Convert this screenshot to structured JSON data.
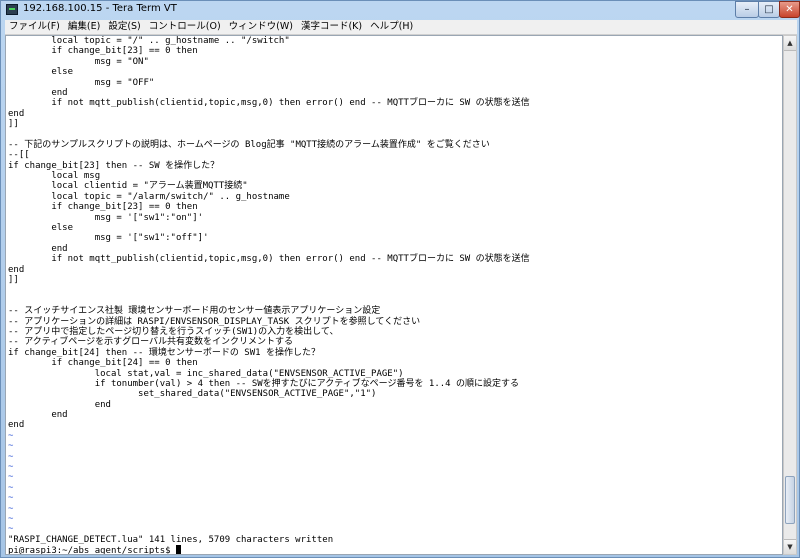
{
  "window": {
    "title": "192.168.100.15 - Tera Term VT",
    "controls": {
      "minimize": "–",
      "maximize": "□",
      "close": "✕"
    }
  },
  "menu": [
    "ファイル(F)",
    "編集(E)",
    "設定(S)",
    "コントロール(O)",
    "ウィンドウ(W)",
    "漢字コード(K)",
    "ヘルプ(H)"
  ],
  "terminal": {
    "lines": [
      "        local topic = \"/\" .. g_hostname .. \"/switch\"",
      "        if change_bit[23] == 0 then",
      "                msg = \"ON\"",
      "        else",
      "                msg = \"OFF\"",
      "        end",
      "        if not mqtt_publish(clientid,topic,msg,0) then error() end -- MQTTブローカに SW の状態を送信",
      "end",
      "]]",
      "",
      "-- 下記のサンプルスクリプトの説明は、ホームページの Blog記事 \"MQTT接続のアラーム装置作成\" をご覧ください",
      "--[[",
      "if change_bit[23] then -- SW を操作した？",
      "        local msg",
      "        local clientid = \"アラーム装置MQTT接続\"",
      "        local topic = \"/alarm/switch/\" .. g_hostname",
      "        if change_bit[23] == 0 then",
      "                msg = '[\"sw1\":\"on\"]'",
      "        else",
      "                msg = '[\"sw1\":\"off\"]'",
      "        end",
      "        if not mqtt_publish(clientid,topic,msg,0) then error() end -- MQTTブローカに SW の状態を送信",
      "end",
      "]]",
      "",
      "",
      "-- スイッチサイエンス社製 環境センサーボード用のセンサー値表示アプリケーション設定",
      "-- アプリケーションの詳細は RASPI/ENVSENSOR_DISPLAY_TASK スクリプトを参照してください",
      "-- アプリ中で指定したページ切り替えを行うスイッチ(SW1)の入力を検出して、",
      "-- アクティブページを示すグローバル共有変数をインクリメントする",
      "if change_bit[24] then -- 環境センサーボードの SW1 を操作した？",
      "        if change_bit[24] == 0 then",
      "                local stat,val = inc_shared_data(\"ENVSENSOR_ACTIVE_PAGE\")",
      "                if tonumber(val) > 4 then -- SWを押すたびにアクティブなページ番号を 1..4 の順に設定する",
      "                        set_shared_data(\"ENVSENSOR_ACTIVE_PAGE\",\"1\")",
      "                end",
      "        end",
      "end",
      "~",
      "~",
      "~",
      "~",
      "~",
      "~",
      "~",
      "~",
      "~",
      "~",
      "\"RASPI_CHANGE_DETECT.lua\" 141 lines, 5709 characters written",
      "pi@raspi3:~/abs_agent/scripts$ "
    ]
  }
}
